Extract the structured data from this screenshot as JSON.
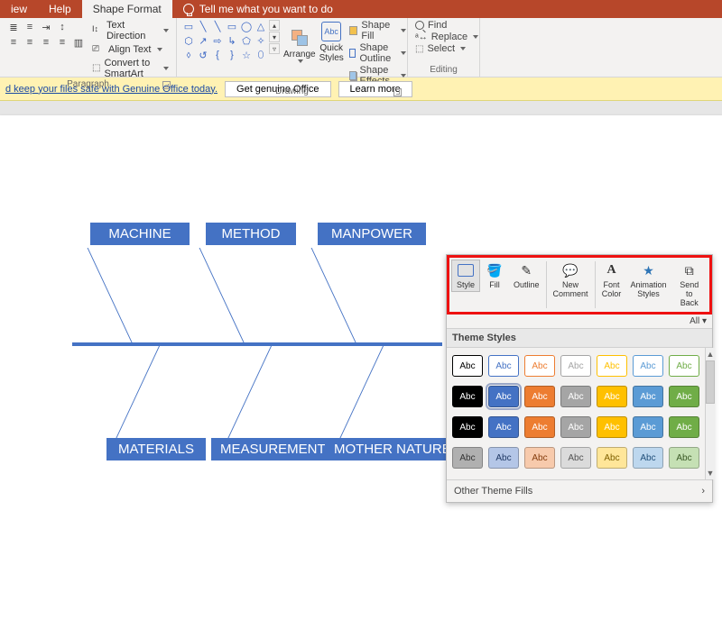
{
  "menubar": {
    "tabs": [
      {
        "label": "iew"
      },
      {
        "label": "Help"
      },
      {
        "label": "Shape Format",
        "active": true
      }
    ],
    "tellme": "Tell me what you want to do"
  },
  "ribbon": {
    "paragraph": {
      "label": "Paragraph",
      "items": {
        "textdir": "Text Direction",
        "aligntext": "Align Text",
        "smartart": "Convert to SmartArt"
      }
    },
    "drawing": {
      "label": "Drawing",
      "arrange": "Arrange",
      "quick": "Quick\nStyles",
      "shapefill": "Shape Fill",
      "shapeoutline": "Shape Outline",
      "shapeeffects": "Shape Effects"
    },
    "editing": {
      "label": "Editing",
      "find": "Find",
      "replace": "Replace",
      "select": "Select"
    }
  },
  "msgbar": {
    "text_left": "d keep your files safe with Genuine Office today.",
    "btn1": "Get genuine Office",
    "btn2": "Learn more"
  },
  "fish": {
    "top": [
      "MACHINE",
      "METHOD",
      "MANPOWER"
    ],
    "bottom": [
      "MATERIALS",
      "MEASUREMENTS",
      "MOTHER NATURE"
    ]
  },
  "fmt": {
    "tools": {
      "style": "Style",
      "fill": "Fill",
      "outline": "Outline",
      "newcomment": "New\nComment",
      "fontcolor": "Font\nColor",
      "animstyles": "Animation\nStyles",
      "sendback": "Send to\nBack"
    },
    "all": "All",
    "theme_header": "Theme Styles",
    "abc": "Abc",
    "other_fills": "Other Theme Fills",
    "swatches": [
      [
        {
          "bg": "#ffffff",
          "fg": "#000",
          "border": "#000"
        },
        {
          "bg": "#ffffff",
          "fg": "#4472c4",
          "border": "#4472c4"
        },
        {
          "bg": "#ffffff",
          "fg": "#ed7d31",
          "border": "#ed7d31"
        },
        {
          "bg": "#ffffff",
          "fg": "#a5a5a5",
          "border": "#a5a5a5"
        },
        {
          "bg": "#ffffff",
          "fg": "#ffc000",
          "border": "#ffc000"
        },
        {
          "bg": "#ffffff",
          "fg": "#5b9bd5",
          "border": "#5b9bd5"
        },
        {
          "bg": "#ffffff",
          "fg": "#70ad47",
          "border": "#70ad47"
        }
      ],
      [
        {
          "bg": "#000000",
          "fg": "#fff"
        },
        {
          "bg": "#4472c4",
          "fg": "#fff",
          "sel": true
        },
        {
          "bg": "#ed7d31",
          "fg": "#fff"
        },
        {
          "bg": "#a5a5a5",
          "fg": "#fff"
        },
        {
          "bg": "#ffc000",
          "fg": "#fff"
        },
        {
          "bg": "#5b9bd5",
          "fg": "#fff"
        },
        {
          "bg": "#70ad47",
          "fg": "#fff"
        }
      ],
      [
        {
          "bg": "#000000",
          "fg": "#fff"
        },
        {
          "bg": "#4472c4",
          "fg": "#fff"
        },
        {
          "bg": "#ed7d31",
          "fg": "#fff"
        },
        {
          "bg": "#a5a5a5",
          "fg": "#fff"
        },
        {
          "bg": "#ffc000",
          "fg": "#fff"
        },
        {
          "bg": "#5b9bd5",
          "fg": "#fff"
        },
        {
          "bg": "#70ad47",
          "fg": "#fff"
        }
      ],
      [
        {
          "bg": "#b0b0b0",
          "fg": "#333"
        },
        {
          "bg": "#b4c6e7",
          "fg": "#1f3864"
        },
        {
          "bg": "#f7caac",
          "fg": "#843c0c"
        },
        {
          "bg": "#dbdbdb",
          "fg": "#525252"
        },
        {
          "bg": "#ffe699",
          "fg": "#7f6000"
        },
        {
          "bg": "#bdd7ee",
          "fg": "#1f4e79"
        },
        {
          "bg": "#c5e0b4",
          "fg": "#385723"
        }
      ]
    ]
  }
}
